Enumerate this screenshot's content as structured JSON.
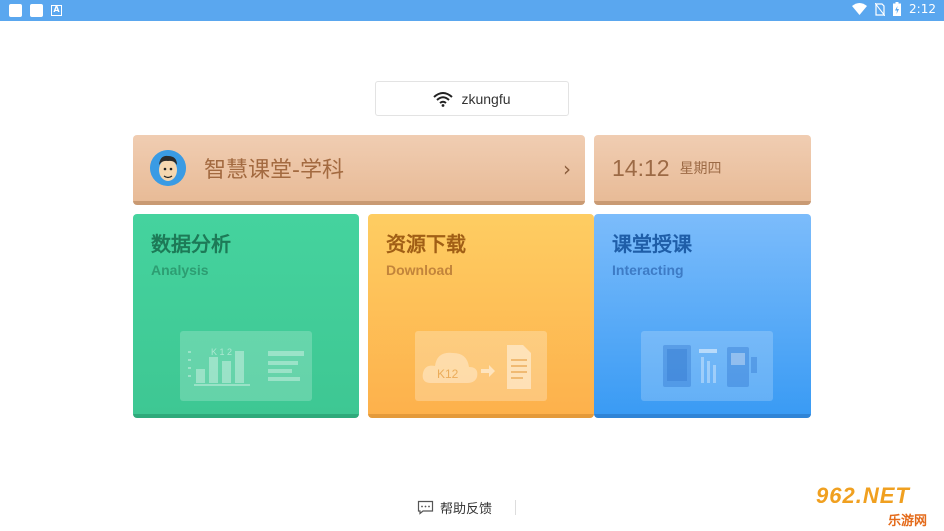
{
  "status_bar": {
    "time": "2:12",
    "icons": [
      "notification-square-icon",
      "notification-square-icon",
      "a-icon",
      "wifi-icon",
      "no-sim-icon",
      "battery-charging-icon"
    ],
    "color": "#5aa7ef"
  },
  "network": {
    "ssid": "zkungfu",
    "icon": "wifi-icon"
  },
  "subject": {
    "title": "智慧课堂-学科",
    "icon": "avatar",
    "chevron": "›"
  },
  "clock": {
    "time": "14:12",
    "weekday": "星期四"
  },
  "tiles": [
    {
      "title": "数据分析",
      "subtitle": "Analysis",
      "icon": "chart-board-icon",
      "color": "#45d39e"
    },
    {
      "title": "资源下载",
      "subtitle": "Download",
      "icon": "cloud-download-icon",
      "color": "#fdc05a"
    },
    {
      "title": "课堂授课",
      "subtitle": "Interacting",
      "icon": "devices-icon",
      "color": "#5fadf8"
    }
  ],
  "help": {
    "label": "帮助反馈",
    "icon": "chat-icon"
  },
  "watermark": {
    "top": "962.NET",
    "bottom": "乐游网"
  }
}
